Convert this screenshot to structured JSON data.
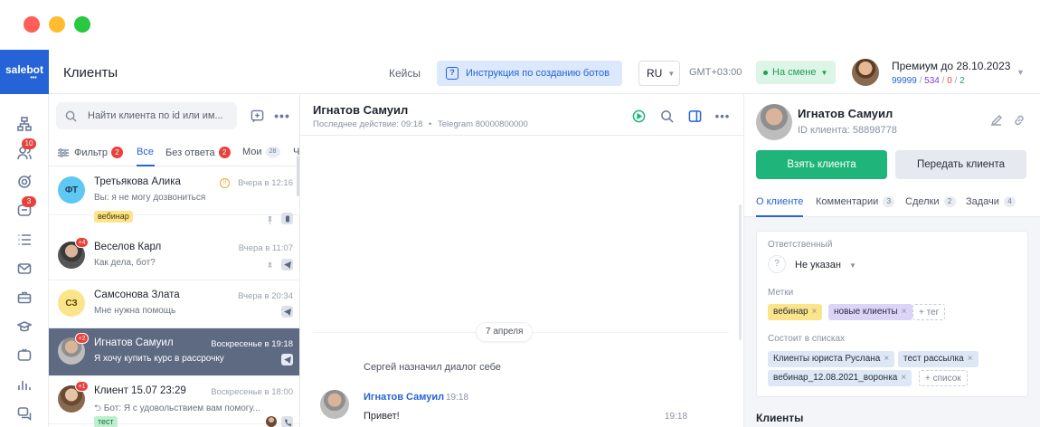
{
  "brand": {
    "logo_text": "salebot",
    "accent": "#2563d6"
  },
  "rail": {
    "items": [
      {
        "icon": "sitemap-icon",
        "badge": ""
      },
      {
        "icon": "users-icon",
        "badge": "10"
      },
      {
        "icon": "target-icon",
        "badge": ""
      },
      {
        "icon": "chat-icon",
        "badge": "3"
      },
      {
        "icon": "list-icon",
        "badge": ""
      },
      {
        "icon": "mail-icon",
        "badge": ""
      },
      {
        "icon": "briefcase-icon",
        "badge": ""
      },
      {
        "icon": "graduation-icon",
        "badge": ""
      },
      {
        "icon": "tv-icon",
        "badge": ""
      },
      {
        "icon": "bar-chart-icon",
        "badge": ""
      },
      {
        "icon": "messages-icon",
        "badge": ""
      }
    ]
  },
  "topbar": {
    "title": "Клиенты",
    "cases": "Кейсы",
    "instruction": "Инструкция по созданию ботов",
    "lang": "RU",
    "timezone": "GMT+03:00",
    "shift": "На смене",
    "premium": "Премиум до 28.10.2023",
    "counts": {
      "a": "99999",
      "b": "534",
      "c": "0",
      "d": "2"
    }
  },
  "clients_panel": {
    "search_placeholder": "Найти клиента по id или им...",
    "tabs": {
      "filter": {
        "label": "Фильтр",
        "badge": "2"
      },
      "all": {
        "label": "Все"
      },
      "unanswered": {
        "label": "Без ответа",
        "badge": "2"
      },
      "mine": {
        "label": "Мои",
        "badge": "28"
      },
      "cut": "Ч"
    },
    "clients": [
      {
        "initials": "ФТ",
        "name": "Третьякова Алика",
        "time": "Вчера в 12:16",
        "message": "Вы: я не могу дозвониться",
        "tag": "вебинар",
        "badge": "",
        "selected": false
      },
      {
        "initials": "",
        "name": "Веселов Карл",
        "time": "Вчера в 11:07",
        "message": "Как дела, бот?",
        "tag": "",
        "badge": "+4",
        "selected": false
      },
      {
        "initials": "СЗ",
        "name": "Самсонова Злата",
        "time": "Вчера в 20:34",
        "message": "Мне нужна помощь",
        "tag": "",
        "badge": "",
        "selected": false
      },
      {
        "initials": "",
        "name": "Игнатов Самуил",
        "time": "Воскресенье в 19:18",
        "message": "Я хочу купить курс в рассрочку",
        "tag": "",
        "badge": "+2",
        "selected": true
      },
      {
        "initials": "",
        "name": "Клиент 15.07 23:29",
        "time": "Воскресенье в 18:00",
        "message": "Бот: Я с удовольствием вам помогу...",
        "tag": "тест",
        "badge": "+1",
        "selected": false
      }
    ]
  },
  "chat": {
    "name": "Игнатов Самуил",
    "last_action": "Последнее действие: 09:18",
    "channel": "Telegram 80000800000",
    "date_separator": "7 апреля",
    "system_message": "Сергей назначил диалог себе",
    "messages": [
      {
        "author": "Игнатов Самуил",
        "time": "19:18",
        "text": "Привет!",
        "sent_time": "19:18"
      }
    ]
  },
  "info": {
    "name": "Игнатов Самуил",
    "client_id": "ID клиента: 58898778",
    "take_button": "Взять клиента",
    "pass_button": "Передать клиента",
    "tabs": [
      {
        "label": "О клиенте",
        "badge": ""
      },
      {
        "label": "Комментарии",
        "badge": "3"
      },
      {
        "label": "Сделки",
        "badge": "2"
      },
      {
        "label": "Задачи",
        "badge": "4"
      }
    ],
    "responsible_label": "Ответственный",
    "responsible_value": "Не указан",
    "tags_label": "Метки",
    "tags": [
      "вебинар",
      "новые клиенты"
    ],
    "add_tag": "+ тег",
    "lists_label": "Состоит в списках",
    "lists": [
      "Клиенты юриста Руслана",
      "тест рассылка",
      "вебинар_12.08.2021_воронка"
    ],
    "add_list": "+ список",
    "clients_section": "Клиенты"
  }
}
